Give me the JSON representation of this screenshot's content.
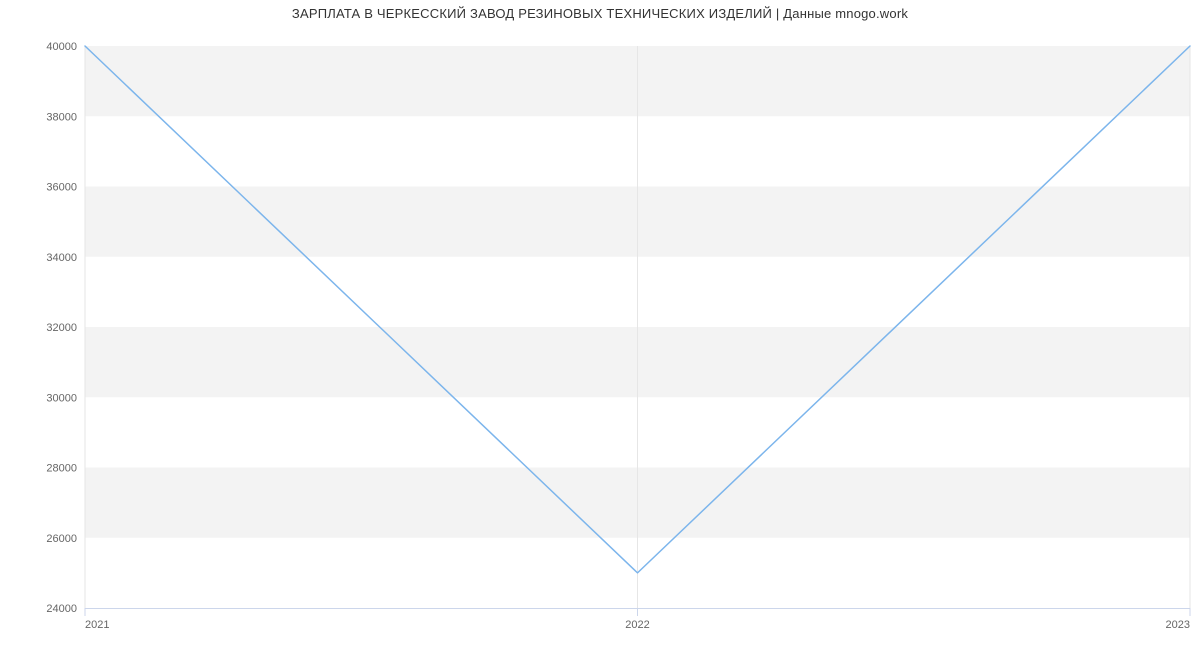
{
  "chart_data": {
    "type": "line",
    "title": "ЗАРПЛАТА В  ЧЕРКЕССКИЙ ЗАВОД РЕЗИНОВЫХ ТЕХНИЧЕСКИХ ИЗДЕЛИЙ | Данные mnogo.work",
    "categories": [
      "2021",
      "2022",
      "2023"
    ],
    "x": [
      2021,
      2022,
      2023
    ],
    "values": [
      40000,
      25000,
      40000
    ],
    "xlabel": "",
    "ylabel": "",
    "ylim": [
      24000,
      40000
    ],
    "y_ticks": [
      24000,
      26000,
      28000,
      30000,
      32000,
      34000,
      36000,
      38000,
      40000
    ],
    "x_ticks": [
      "2021",
      "2022",
      "2023"
    ],
    "grid": true,
    "line_color": "#7cb5ec",
    "band_color": "#f3f3f3"
  }
}
